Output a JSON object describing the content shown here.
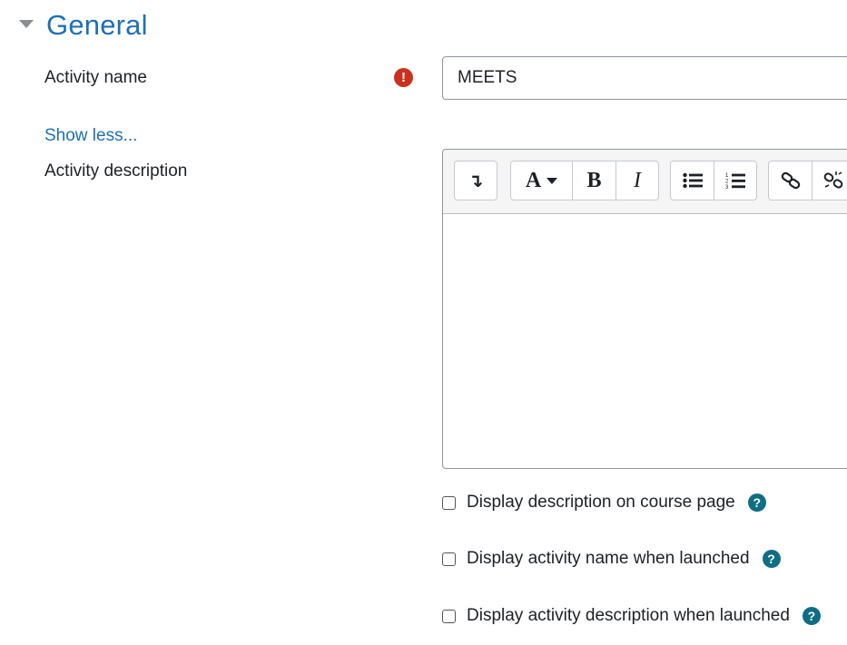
{
  "section": {
    "title": "General"
  },
  "fields": {
    "activity_name": {
      "label": "Activity name",
      "value": "MEETS",
      "required_icon": "!"
    },
    "show_less_link": "Show less...",
    "activity_description": {
      "label": "Activity description"
    }
  },
  "toolbar": {
    "buttons": [
      {
        "name": "toolbar-toggle",
        "icon": "arrow-down-icon",
        "glyph": "↴"
      },
      {
        "name": "font-style",
        "icon": "font-icon",
        "glyph": "A"
      },
      {
        "name": "bold",
        "icon": "bold-icon",
        "glyph": "B"
      },
      {
        "name": "italic",
        "icon": "italic-icon",
        "glyph": "I"
      },
      {
        "name": "unordered-list",
        "icon": "bullet-list-icon"
      },
      {
        "name": "ordered-list",
        "icon": "numbered-list-icon"
      },
      {
        "name": "link",
        "icon": "link-icon"
      },
      {
        "name": "unlink",
        "icon": "unlink-icon"
      }
    ]
  },
  "checkboxes": [
    {
      "label": "Display description on course page",
      "checked": false,
      "help": "?"
    },
    {
      "label": "Display activity name when launched",
      "checked": false,
      "help": "?"
    },
    {
      "label": "Display activity description when launched",
      "checked": false,
      "help": "?"
    }
  ],
  "colors": {
    "link": "#1f6fb5",
    "required": "#ca3120",
    "help": "#0f6e84"
  }
}
